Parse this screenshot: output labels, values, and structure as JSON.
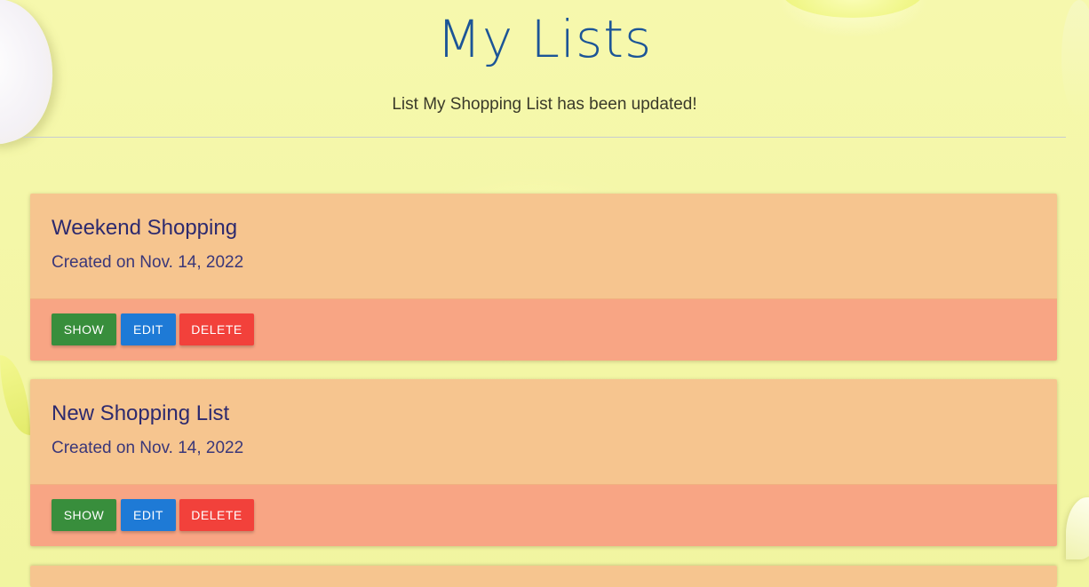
{
  "page": {
    "title": "My Lists",
    "flash_message": "List My Shopping List has been updated!"
  },
  "lists": [
    {
      "title": "Weekend Shopping",
      "created": "Created on Nov. 14, 2022",
      "show_label": "SHOW",
      "edit_label": "EDIT",
      "delete_label": "DELETE"
    },
    {
      "title": "New Shopping List",
      "created": "Created on Nov. 14, 2022",
      "show_label": "SHOW",
      "edit_label": "EDIT",
      "delete_label": "DELETE"
    }
  ],
  "colors": {
    "background": "#f5f8a6",
    "title": "#1c5597",
    "card_content": "#f6c58f",
    "card_actions": "#f8a584",
    "show_button": "#388e3c",
    "edit_button": "#1e7ad6",
    "delete_button": "#f2413b"
  }
}
